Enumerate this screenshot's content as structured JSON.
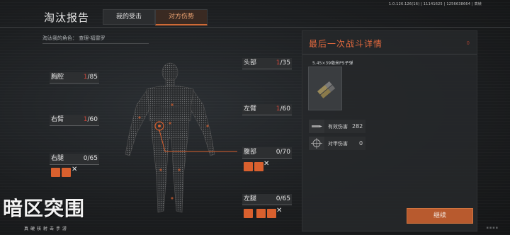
{
  "version_text": "1.0.126.126(16) | 11141625 | 1256638664 | 高帧",
  "header": {
    "title": "淘汰报告",
    "tabs": [
      {
        "label": "我的受击",
        "active": false
      },
      {
        "label": "对方伤势",
        "active": true
      }
    ]
  },
  "role_label": "淘汰我的角色：  查理·福雷罗",
  "body_parts": {
    "chest": {
      "name": "胸腔",
      "damage": "1",
      "max": "/85"
    },
    "right_arm": {
      "name": "右臂",
      "damage": "1",
      "max": "/60"
    },
    "right_leg": {
      "name": "右腿",
      "damage": "0",
      "max": "/65"
    },
    "head": {
      "name": "头部",
      "damage": "1",
      "max": "/35"
    },
    "left_arm": {
      "name": "左臂",
      "damage": "1",
      "max": "/60"
    },
    "abdomen": {
      "name": "腹部",
      "damage": "0",
      "max": "/70"
    },
    "left_leg": {
      "name": "左腿",
      "damage": "0",
      "max": "/65"
    }
  },
  "panel": {
    "title": "最后一次战斗详情",
    "mark": "0",
    "ammo_name": "5.45×39毫米PS子弹",
    "stats": [
      {
        "label": "有效伤害",
        "value": "282",
        "icon": "bullet-icon"
      },
      {
        "label": "对甲伤害",
        "value": "0",
        "icon": "crosshair-icon"
      }
    ],
    "continue_label": "继续"
  },
  "logo": {
    "title": "暗区突围",
    "subtitle": "真硬核射击手游"
  },
  "colors": {
    "accent": "#d9602e",
    "damage": "#d0473b",
    "tab_active": "#e8a070"
  }
}
